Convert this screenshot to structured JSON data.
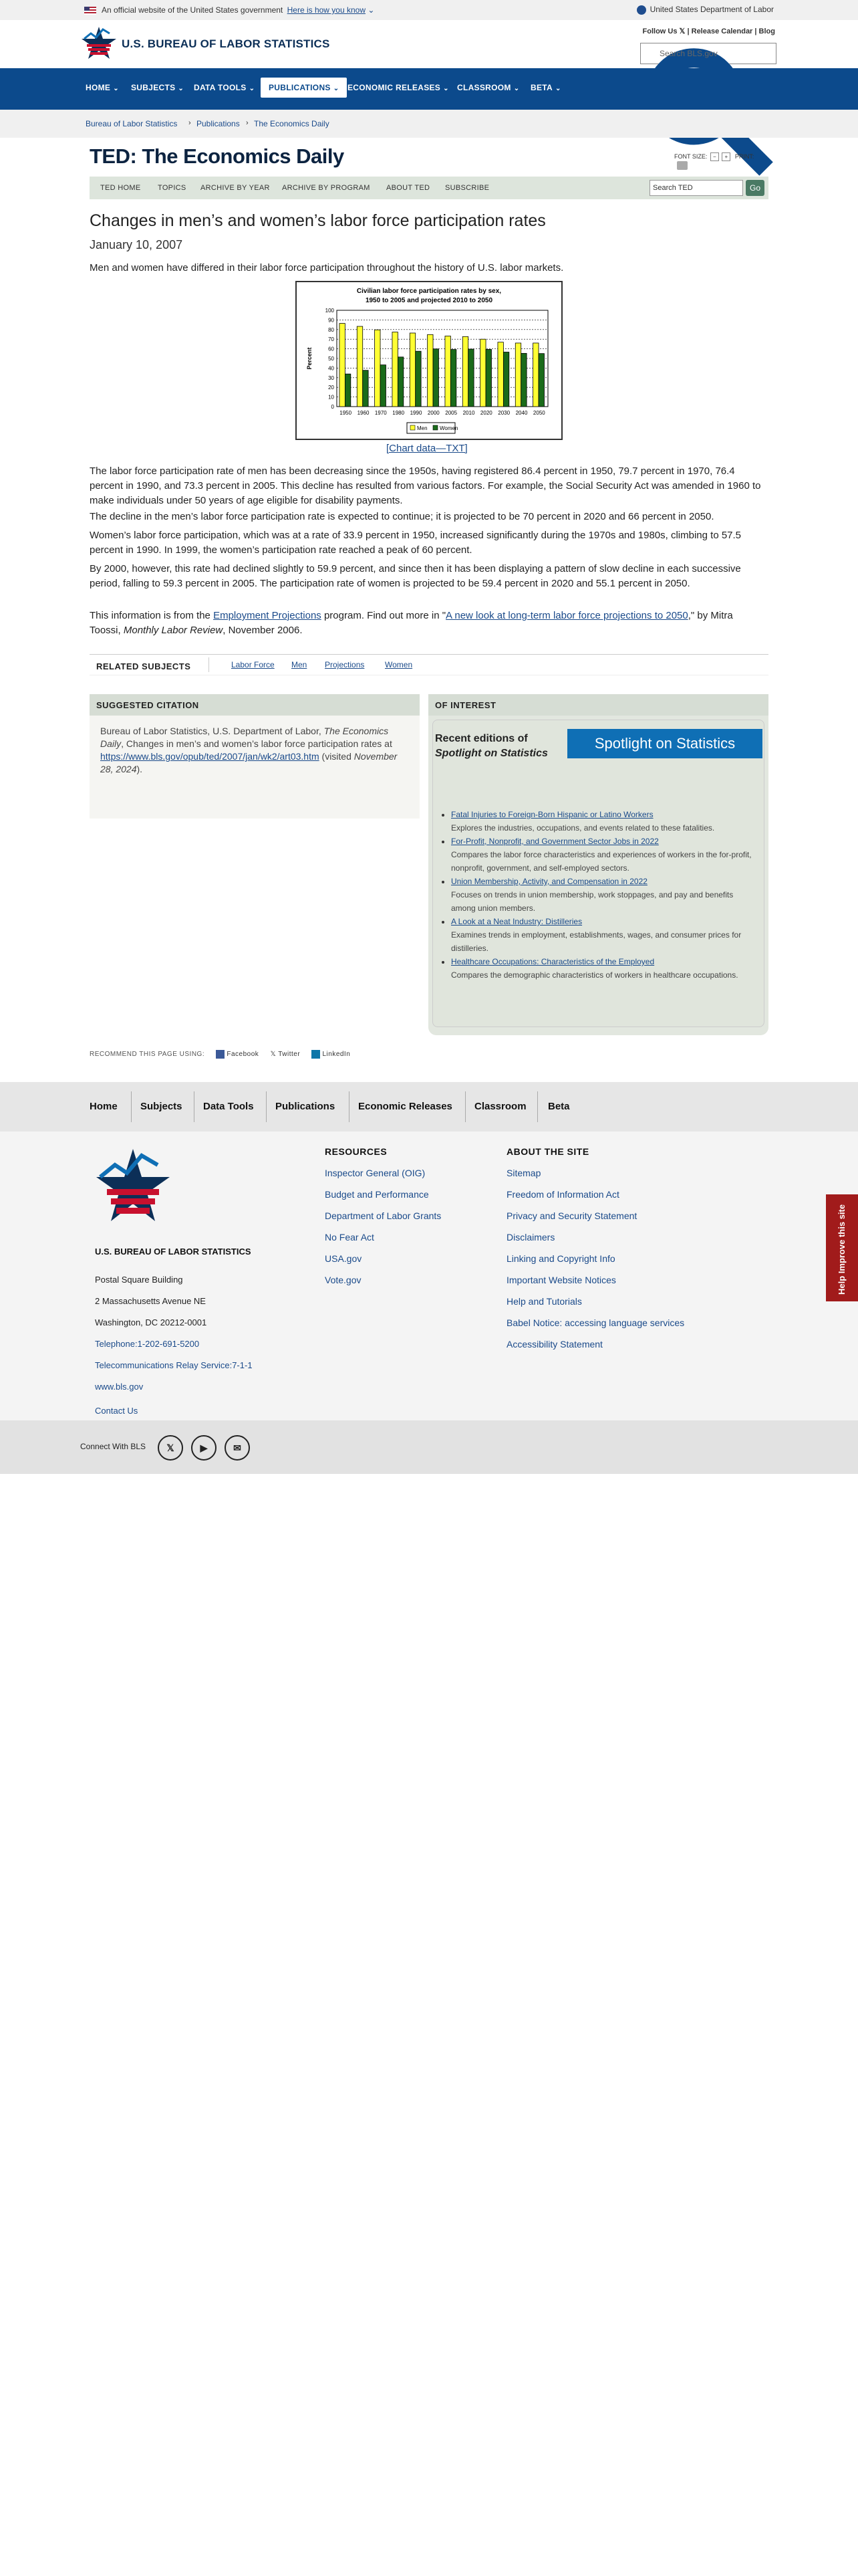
{
  "gov_banner": {
    "official_text": "An official website of the United States government",
    "how_to_know": "Here is how you know",
    "dol_link": "United States Department of Labor"
  },
  "header": {
    "site_name": "U.S. BUREAU OF LABOR STATISTICS",
    "follow_us": "Follow Us",
    "release_calendar": "Release Calendar",
    "blog": "Blog",
    "search_placeholder": "Search BLS.gov"
  },
  "nav": {
    "items": [
      {
        "label": "HOME"
      },
      {
        "label": "SUBJECTS"
      },
      {
        "label": "DATA TOOLS"
      },
      {
        "label": "PUBLICATIONS"
      },
      {
        "label": "ECONOMIC RELEASES"
      },
      {
        "label": "CLASSROOM"
      },
      {
        "label": "BETA"
      }
    ],
    "active": "PUBLICATIONS"
  },
  "breadcrumb": [
    "Bureau of Labor Statistics",
    "Publications",
    "The Economics Daily"
  ],
  "ted": {
    "title": "TED: The Economics Daily",
    "font_size_label": "FONT SIZE:",
    "font_minus": "−",
    "font_plus": "+",
    "print_label": "PRINT:",
    "nav": [
      "TED HOME",
      "TOPICS",
      "ARCHIVE BY YEAR",
      "ARCHIVE BY PROGRAM",
      "ABOUT TED",
      "SUBSCRIBE"
    ],
    "search_value": "Search TED",
    "go_label": "Go"
  },
  "article": {
    "title": "Changes in men’s and women’s labor force participation rates",
    "date": "January 10, 2007",
    "intro": "Men and women have differed in their labor force participation throughout the history of U.S. labor markets.",
    "chart_link": "[Chart data—TXT]",
    "p1": "The labor force participation rate of men has been decreasing since the 1950s, having registered 86.4 percent in 1950, 79.7 percent in 1970, 76.4 percent in 1990, and 73.3 percent in 2005. This decline has resulted from various factors. For example, the Social Security Act was amended in 1960 to make individuals under 50 years of age eligible for disability payments.",
    "p2": "The decline in the men’s labor force participation rate is expected to continue; it is projected to be 70 percent in 2020 and 66 percent in 2050.",
    "p3": "Women’s labor force participation, which was at a rate of 33.9 percent in 1950, increased significantly during the 1970s and 1980s, climbing to 57.5 percent in 1990. In 1999, the women’s participation rate reached a peak of 60 percent.",
    "p4": "By 2000, however, this rate had declined slightly to 59.9 percent, and since then it has been displaying a pattern of slow decline in each successive period, falling to 59.3 percent in 2005. The participation rate of women is projected to be 59.4 percent in 2020 and 55.1 percent in 2050.",
    "p5_a": "This information is from the ",
    "p5_link1": "Employment Projections",
    "p5_b": " program. Find out more in \"",
    "p5_link2": "A new look at long-term labor force projections to 2050",
    "p5_c": ",\" by Mitra Toossi, ",
    "p5_journal": "Monthly Labor Review",
    "p5_d": ", November 2006."
  },
  "chart_data": {
    "type": "bar",
    "title": "Civilian labor force participation rates by sex,",
    "subtitle": "1950 to 2005 and projected 2010 to 2050",
    "ylabel": "Percent",
    "ylim": [
      0,
      100
    ],
    "yticks": [
      0,
      10,
      20,
      30,
      40,
      50,
      60,
      70,
      80,
      90,
      100
    ],
    "categories": [
      "1950",
      "1960",
      "1970",
      "1980",
      "1990",
      "2000",
      "2005",
      "2010",
      "2020",
      "2030",
      "2040",
      "2050"
    ],
    "series": [
      {
        "name": "Men",
        "color": "#ffff33",
        "values": [
          86.4,
          83.3,
          79.7,
          77.4,
          76.4,
          74.8,
          73.3,
          72.7,
          70.0,
          66.9,
          66.0,
          66.0
        ]
      },
      {
        "name": "Women",
        "color": "#1a6b1a",
        "values": [
          33.9,
          37.7,
          43.3,
          51.5,
          57.5,
          59.9,
          59.3,
          59.7,
          59.4,
          56.6,
          55.3,
          55.1
        ]
      }
    ],
    "grid": true,
    "legend": "bottom"
  },
  "related": {
    "title": "RELATED SUBJECTS",
    "links": [
      "Labor Force",
      "Men",
      "Projections",
      "Women"
    ]
  },
  "citation": {
    "title": "SUGGESTED CITATION",
    "text_a": "Bureau of Labor Statistics, U.S. Department of Labor, ",
    "text_ted": "The Economics Daily",
    "text_b": ", Changes in men’s and women’s labor force participation rates at ",
    "url": "https://www.bls.gov/opub/ted/2007/jan/wk2/art03.htm",
    "text_c": " (visited ",
    "visited": "November 28, 2024",
    "text_d": ")."
  },
  "interest": {
    "title": "OF INTEREST",
    "recent": "Recent editions of",
    "spotlight_name": "Spotlight on Statistics",
    "banner": "Spotlight on Statistics",
    "items": [
      {
        "title": "Fatal Injuries to Foreign-Born Hispanic or Latino Workers",
        "desc": "Explores the industries, occupations, and events related to these fatalities."
      },
      {
        "title": "For-Profit, Nonprofit, and Government Sector Jobs in 2022",
        "desc": "Compares the labor force characteristics and experiences of workers in the for-profit, nonprofit, government, and self-employed sectors."
      },
      {
        "title": "Union Membership, Activity, and Compensation in 2022",
        "desc": "Focuses on trends in union membership, work stoppages, and pay and benefits among union members."
      },
      {
        "title": "A Look at a Neat Industry: Distilleries",
        "desc": "Examines trends in employment, establishments, wages, and consumer prices for distilleries."
      },
      {
        "title": "Healthcare Occupations: Characteristics of the Employed",
        "desc": "Compares the demographic characteristics of workers in healthcare occupations."
      }
    ]
  },
  "recommend": {
    "label": "RECOMMEND THIS PAGE USING:",
    "facebook": "Facebook",
    "twitter": "Twitter",
    "linkedin": "LinkedIn"
  },
  "footer_nav": [
    "Home",
    "Subjects",
    "Data Tools",
    "Publications",
    "Economic Releases",
    "Classroom",
    "Beta"
  ],
  "footer": {
    "org_name": "U.S. BUREAU OF LABOR STATISTICS",
    "address": [
      "Postal Square Building",
      "2 Massachusetts Avenue NE",
      "Washington, DC 20212-0001"
    ],
    "phone": "Telephone:1-202-691-5200",
    "relay": "Telecommunications Relay Service:7-1-1",
    "website": "www.bls.gov",
    "contact": "Contact Us",
    "resources_title": "RESOURCES",
    "resources": [
      "Inspector General (OIG)",
      "Budget and Performance",
      "Department of Labor Grants",
      "No Fear Act",
      "USA.gov",
      "Vote.gov"
    ],
    "about_title": "ABOUT THE SITE",
    "about": [
      "Sitemap",
      "Freedom of Information Act",
      "Privacy and Security Statement",
      "Disclaimers",
      "Linking and Copyright Info",
      "Important Website Notices",
      "Help and Tutorials",
      "Babel Notice: accessing language services",
      "Accessibility Statement"
    ]
  },
  "connect": {
    "label": "Connect With BLS",
    "x": "𝕏",
    "youtube": "▶",
    "email": "✉"
  },
  "help_tab": "Help Improve this site"
}
